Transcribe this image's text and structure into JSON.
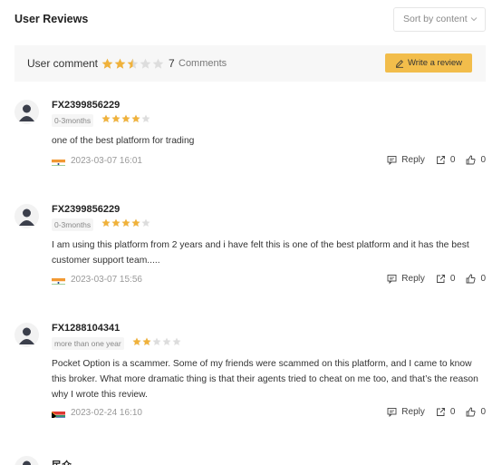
{
  "page": {
    "title": "User Reviews",
    "sort_label": "Sort by content",
    "sort_icon": "chevron-down-icon"
  },
  "summary": {
    "label": "User comment",
    "rating": 2.5,
    "count": "7",
    "count_label": "Comments",
    "write_button": "Write a review"
  },
  "colors": {
    "accent": "#f2bd4b",
    "star_filled": "#f0b23b",
    "star_empty": "#dddddd"
  },
  "reviews": [
    {
      "user": "FX2399856229",
      "period": "0-3months",
      "rating": 4,
      "text": "one of the best platform for trading",
      "flag": "india",
      "date": "2023-03-07 16:01",
      "reply": "Reply",
      "shares": "0",
      "likes": "0"
    },
    {
      "user": "FX2399856229",
      "period": "0-3months",
      "rating": 4,
      "text": "I am using this platform from 2 years and i have felt this is one of the best platform and it has the best customer support team.....",
      "flag": "india",
      "date": "2023-03-07 15:56",
      "reply": "Reply",
      "shares": "0",
      "likes": "0"
    },
    {
      "user": "FX1288104341",
      "period": "more than one year",
      "rating": 2,
      "text": "Pocket Option is a scammer. Some of my friends were scammed on this platform, and I came to know this broker. What more dramatic thing is that their agents tried to cheat on me too, and that’s the reason why I wrote this review.",
      "flag": "south-africa",
      "date": "2023-02-24 16:10",
      "reply": "Reply",
      "shares": "0",
      "likes": "0"
    },
    {
      "user": "民众"
    }
  ]
}
